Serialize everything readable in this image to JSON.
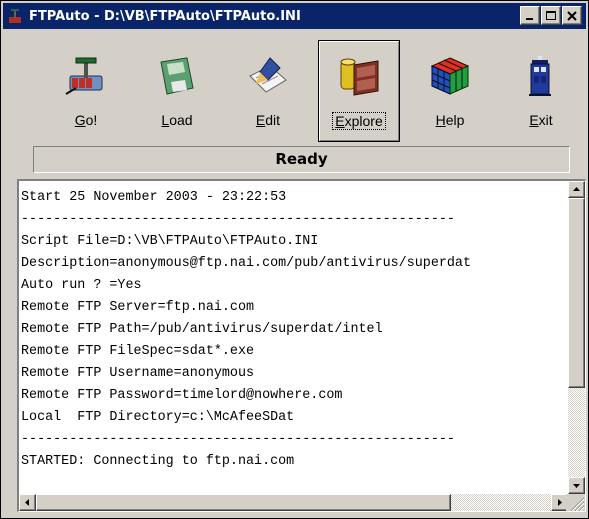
{
  "window": {
    "title": "FTPAuto - D:\\VB\\FTPAuto\\FTPAuto.INI"
  },
  "toolbar": {
    "buttons": [
      {
        "key": "G",
        "rest": "o!",
        "icon": "tnt-plunger-icon"
      },
      {
        "key": "L",
        "rest": "oad",
        "icon": "floppy-disk-icon"
      },
      {
        "key": "E",
        "rest": "dit",
        "icon": "notepad-pen-icon"
      },
      {
        "key": "E",
        "rest": "xplore",
        "icon": "film-roll-icon"
      },
      {
        "key": "H",
        "rest": "elp",
        "icon": "rubiks-cube-icon"
      },
      {
        "key": "E",
        "rest": "xit",
        "icon": "police-box-icon"
      }
    ],
    "active": "Explore"
  },
  "status": {
    "text": "Ready"
  },
  "log": {
    "lines": [
      "Start 25 November 2003 - 23:22:53",
      "------------------------------------------------------",
      "Script File=D:\\VB\\FTPAuto\\FTPAuto.INI",
      "Description=anonymous@ftp.nai.com/pub/antivirus/superdat",
      "Auto run ? =Yes",
      "Remote FTP Server=ftp.nai.com",
      "Remote FTP Path=/pub/antivirus/superdat/intel",
      "Remote FTP FileSpec=sdat*.exe",
      "Remote FTP Username=anonymous",
      "Remote FTP Password=timelord@nowhere.com",
      "Local  FTP Directory=c:\\McAfeeSDat",
      "------------------------------------------------------",
      "STARTED: Connecting to ftp.nai.com"
    ]
  },
  "colors": {
    "titlebar": "#0a246a",
    "face": "#d4d0c8"
  }
}
